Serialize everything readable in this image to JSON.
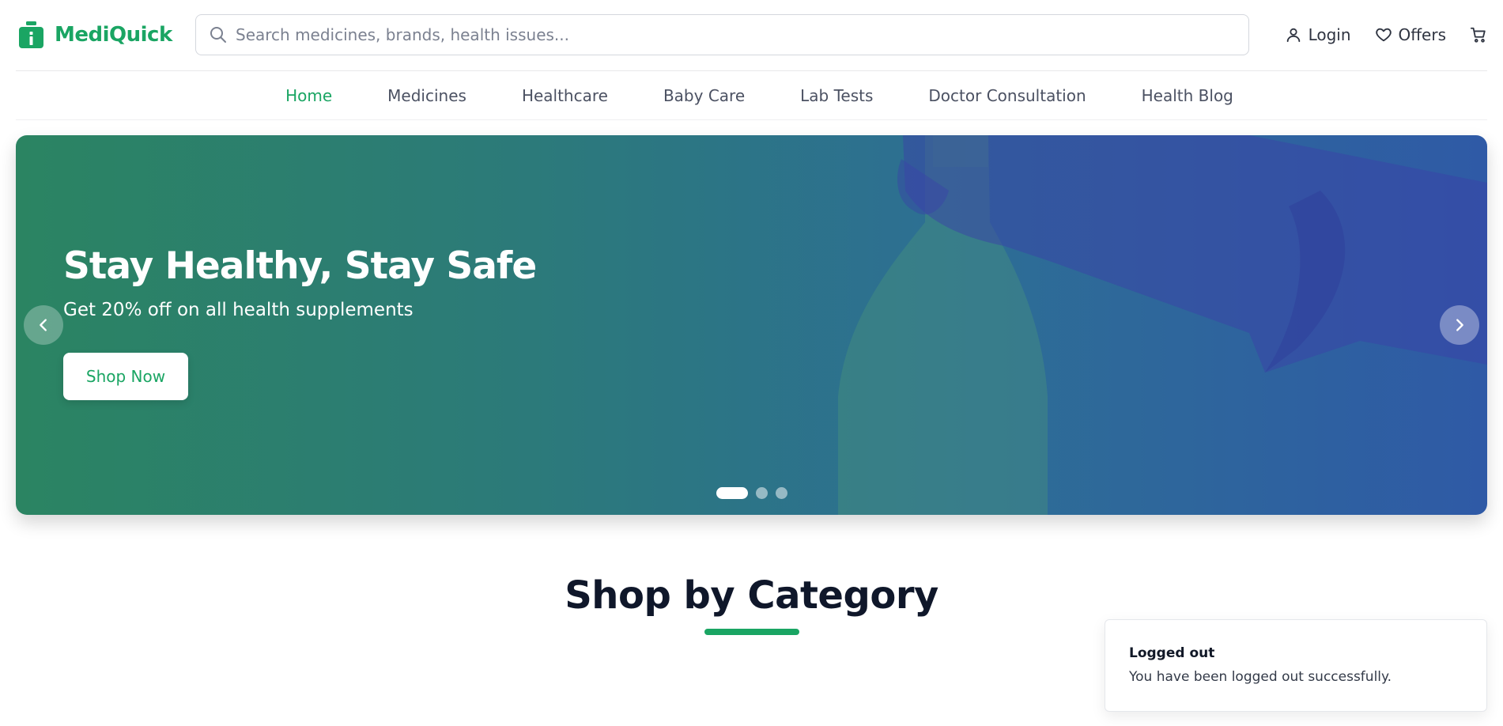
{
  "brand": {
    "name": "MediQuick",
    "color": "#1aa563"
  },
  "search": {
    "placeholder": "Search medicines, brands, health issues...",
    "value": ""
  },
  "header_actions": {
    "login_label": "Login",
    "offers_label": "Offers"
  },
  "nav": {
    "items": [
      {
        "label": "Home",
        "active": true
      },
      {
        "label": "Medicines",
        "active": false
      },
      {
        "label": "Healthcare",
        "active": false
      },
      {
        "label": "Baby Care",
        "active": false
      },
      {
        "label": "Lab Tests",
        "active": false
      },
      {
        "label": "Doctor Consultation",
        "active": false
      },
      {
        "label": "Health Blog",
        "active": false
      }
    ]
  },
  "hero": {
    "title": "Stay Healthy, Stay Safe",
    "subtitle": "Get 20% off on all health supplements",
    "cta_label": "Shop Now",
    "slide_count": 3,
    "active_slide": 1,
    "gradient_start": "#2b8462",
    "gradient_end": "#2f5aa6"
  },
  "section": {
    "title": "Shop by Category"
  },
  "toast": {
    "title": "Logged out",
    "message": "You have been logged out successfully."
  }
}
